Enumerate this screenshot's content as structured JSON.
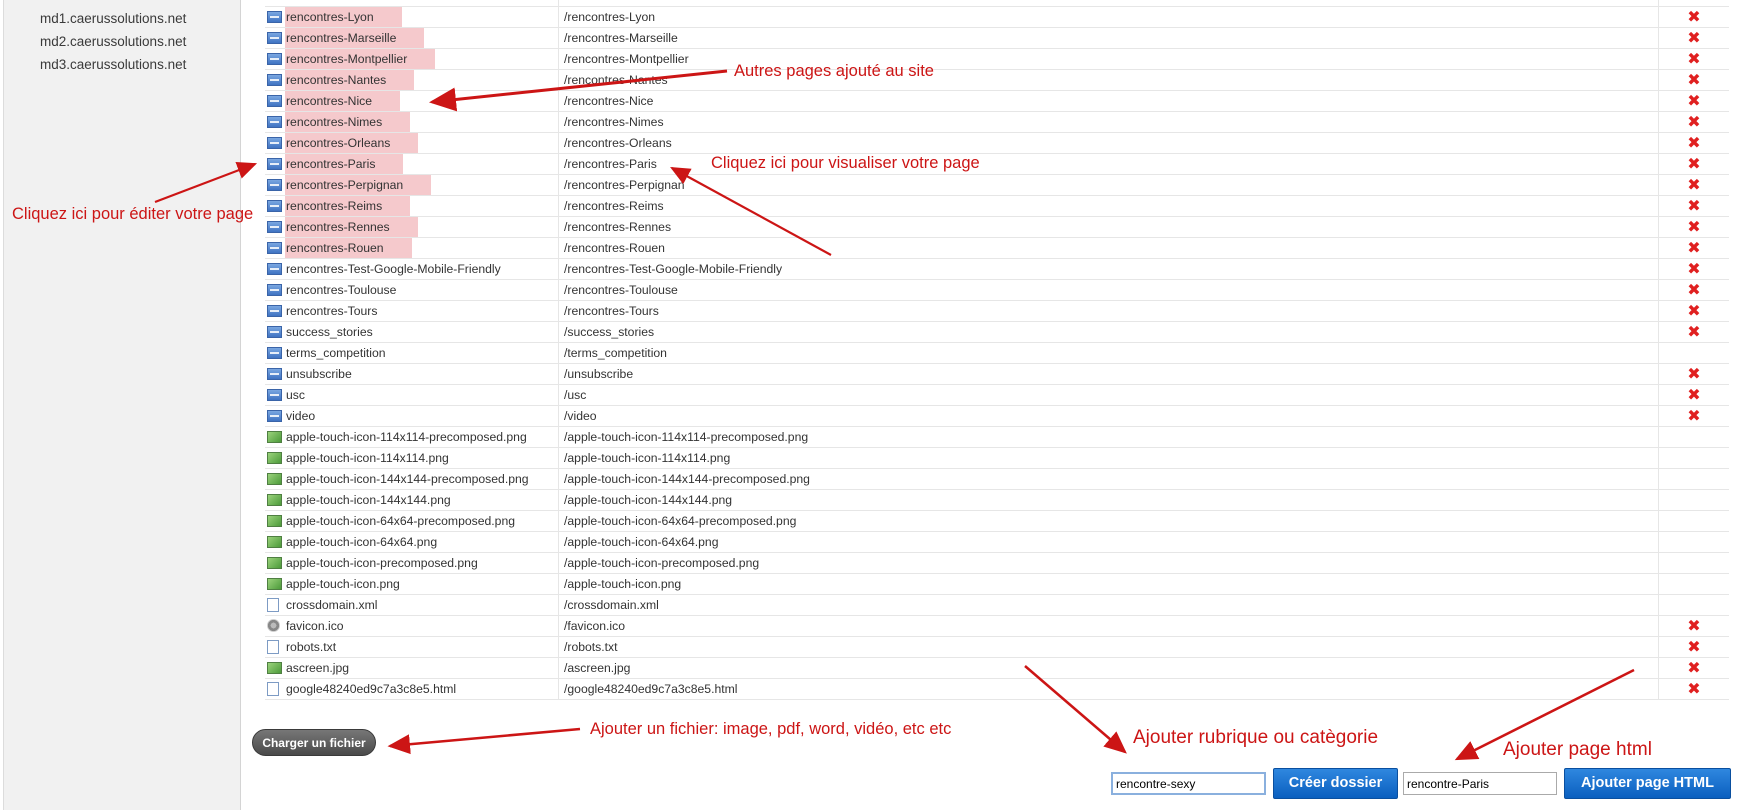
{
  "sidebar": {
    "domains": [
      "md1.caerussolutions.net",
      "md2.caerussolutions.net",
      "md3.caerussolutions.net"
    ]
  },
  "files": [
    {
      "name": "rencontres-Lyon",
      "path": "/rencontres-Lyon",
      "icon": "html-file-icon",
      "highlight": true,
      "deletable": true
    },
    {
      "name": "rencontres-Marseille",
      "path": "/rencontres-Marseille",
      "icon": "html-file-icon",
      "highlight": true,
      "deletable": true
    },
    {
      "name": "rencontres-Montpellier",
      "path": "/rencontres-Montpellier",
      "icon": "html-file-icon",
      "highlight": true,
      "deletable": true
    },
    {
      "name": "rencontres-Nantes",
      "path": "/rencontres-Nantes",
      "icon": "html-file-icon",
      "highlight": true,
      "deletable": true
    },
    {
      "name": "rencontres-Nice",
      "path": "/rencontres-Nice",
      "icon": "html-file-icon",
      "highlight": true,
      "deletable": true
    },
    {
      "name": "rencontres-Nimes",
      "path": "/rencontres-Nimes",
      "icon": "html-file-icon",
      "highlight": true,
      "deletable": true
    },
    {
      "name": "rencontres-Orleans",
      "path": "/rencontres-Orleans",
      "icon": "html-file-icon",
      "highlight": true,
      "deletable": true
    },
    {
      "name": "rencontres-Paris",
      "path": "/rencontres-Paris",
      "icon": "html-file-icon",
      "highlight": true,
      "deletable": true
    },
    {
      "name": "rencontres-Perpignan",
      "path": "/rencontres-Perpignan",
      "icon": "html-file-icon",
      "highlight": true,
      "deletable": true
    },
    {
      "name": "rencontres-Reims",
      "path": "/rencontres-Reims",
      "icon": "html-file-icon",
      "highlight": true,
      "deletable": true
    },
    {
      "name": "rencontres-Rennes",
      "path": "/rencontres-Rennes",
      "icon": "html-file-icon",
      "highlight": true,
      "deletable": true
    },
    {
      "name": "rencontres-Rouen",
      "path": "/rencontres-Rouen",
      "icon": "html-file-icon",
      "highlight": true,
      "deletable": true
    },
    {
      "name": "rencontres-Test-Google-Mobile-Friendly",
      "path": "/rencontres-Test-Google-Mobile-Friendly",
      "icon": "html-file-icon",
      "highlight": false,
      "deletable": true
    },
    {
      "name": "rencontres-Toulouse",
      "path": "/rencontres-Toulouse",
      "icon": "html-file-icon",
      "highlight": false,
      "deletable": true
    },
    {
      "name": "rencontres-Tours",
      "path": "/rencontres-Tours",
      "icon": "html-file-icon",
      "highlight": false,
      "deletable": true
    },
    {
      "name": "success_stories",
      "path": "/success_stories",
      "icon": "html-file-icon",
      "highlight": false,
      "deletable": true
    },
    {
      "name": "terms_competition",
      "path": "/terms_competition",
      "icon": "html-file-icon",
      "highlight": false,
      "deletable": false
    },
    {
      "name": "unsubscribe",
      "path": "/unsubscribe",
      "icon": "html-file-icon",
      "highlight": false,
      "deletable": true
    },
    {
      "name": "usc",
      "path": "/usc",
      "icon": "html-file-icon",
      "highlight": false,
      "deletable": true
    },
    {
      "name": "video",
      "path": "/video",
      "icon": "html-file-icon",
      "highlight": false,
      "deletable": true
    },
    {
      "name": "apple-touch-icon-114x114-precomposed.png",
      "path": "/apple-touch-icon-114x114-precomposed.png",
      "icon": "image-file-icon",
      "highlight": false,
      "deletable": false
    },
    {
      "name": "apple-touch-icon-114x114.png",
      "path": "/apple-touch-icon-114x114.png",
      "icon": "image-file-icon",
      "highlight": false,
      "deletable": false
    },
    {
      "name": "apple-touch-icon-144x144-precomposed.png",
      "path": "/apple-touch-icon-144x144-precomposed.png",
      "icon": "image-file-icon",
      "highlight": false,
      "deletable": false
    },
    {
      "name": "apple-touch-icon-144x144.png",
      "path": "/apple-touch-icon-144x144.png",
      "icon": "image-file-icon",
      "highlight": false,
      "deletable": false
    },
    {
      "name": "apple-touch-icon-64x64-precomposed.png",
      "path": "/apple-touch-icon-64x64-precomposed.png",
      "icon": "image-file-icon",
      "highlight": false,
      "deletable": false
    },
    {
      "name": "apple-touch-icon-64x64.png",
      "path": "/apple-touch-icon-64x64.png",
      "icon": "image-file-icon",
      "highlight": false,
      "deletable": false
    },
    {
      "name": "apple-touch-icon-precomposed.png",
      "path": "/apple-touch-icon-precomposed.png",
      "icon": "image-file-icon",
      "highlight": false,
      "deletable": false
    },
    {
      "name": "apple-touch-icon.png",
      "path": "/apple-touch-icon.png",
      "icon": "image-file-icon",
      "highlight": false,
      "deletable": false
    },
    {
      "name": "crossdomain.xml",
      "path": "/crossdomain.xml",
      "icon": "document-file-icon",
      "highlight": false,
      "deletable": false
    },
    {
      "name": "favicon.ico",
      "path": "/favicon.ico",
      "icon": "gear-file-icon",
      "highlight": false,
      "deletable": true
    },
    {
      "name": "robots.txt",
      "path": "/robots.txt",
      "icon": "document-file-icon",
      "highlight": false,
      "deletable": true
    },
    {
      "name": "ascreen.jpg",
      "path": "/ascreen.jpg",
      "icon": "image-file-icon",
      "highlight": false,
      "deletable": true
    },
    {
      "name": "google48240ed9c7a3c8e5.html",
      "path": "/google48240ed9c7a3c8e5.html",
      "icon": "document-file-icon",
      "highlight": false,
      "deletable": true
    }
  ],
  "delete_glyph": "✖",
  "annotations": {
    "other_pages": "Autres pages ajouté au site",
    "view_page": "Cliquez ici pour visualiser votre page",
    "edit_page": "Cliquez ici pour éditer votre page",
    "add_file": "Ajouter un fichier: image, pdf, word, vidéo, etc etc",
    "add_category": "Ajouter rubrique ou catègorie",
    "add_html": "Ajouter page html"
  },
  "actions": {
    "upload_label": "Charger un fichier",
    "folder_input_value": "rencontre-sexy",
    "create_folder_label": "Créer dossier",
    "page_input_value": "rencontre-Paris",
    "add_page_label": "Ajouter page HTML"
  },
  "colors": {
    "annotation_red": "#cc1515",
    "highlight_pink": "#f5c9cc",
    "button_blue": "#0a5fbf",
    "delete_red": "#e02020"
  }
}
